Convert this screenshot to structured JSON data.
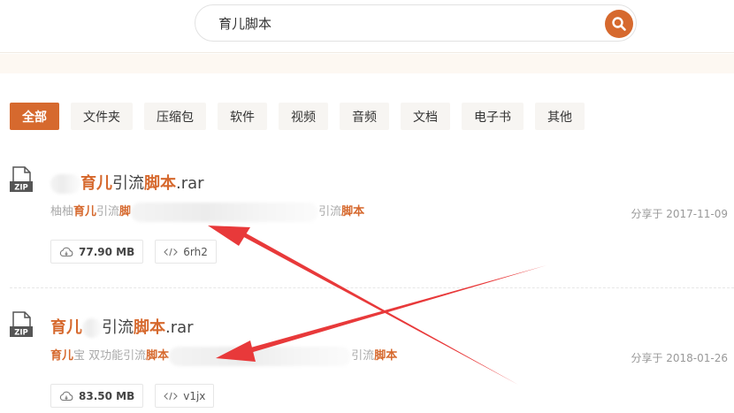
{
  "search": {
    "query": "育儿脚本"
  },
  "tabs": [
    {
      "label": "全部",
      "active": true
    },
    {
      "label": "文件夹"
    },
    {
      "label": "压缩包"
    },
    {
      "label": "软件"
    },
    {
      "label": "视频"
    },
    {
      "label": "音频"
    },
    {
      "label": "文档"
    },
    {
      "label": "电子书"
    },
    {
      "label": "其他"
    }
  ],
  "results": [
    {
      "file_type": "ZIP",
      "title_hl1": "育儿",
      "title_mid": "引流",
      "title_hl2": "脚本",
      "title_ext": ".rar",
      "desc_pre": "柚柚",
      "desc_hl1": "育儿",
      "desc_mid": "引流",
      "desc_hl2": "脚",
      "desc_tail_plain": "引流",
      "desc_tail_hl": "脚本",
      "date": "分享于 2017-11-09",
      "size": "77.90 MB",
      "code": "6rh2"
    },
    {
      "file_type": "ZIP",
      "title_hl1": "育儿",
      "title_mid": "引流",
      "title_hl2": "脚本",
      "title_ext": ".rar",
      "desc_hl1": "育儿",
      "desc_mid": "宝 双功能引流",
      "desc_hl2": "脚本",
      "desc_tail_plain": "引流",
      "desc_tail_hl": "脚本",
      "date": "分享于 2018-01-26",
      "size": "83.50 MB",
      "code": "v1jx"
    }
  ],
  "colors": {
    "accent": "#d6692e",
    "arrow": "#e8393a"
  }
}
